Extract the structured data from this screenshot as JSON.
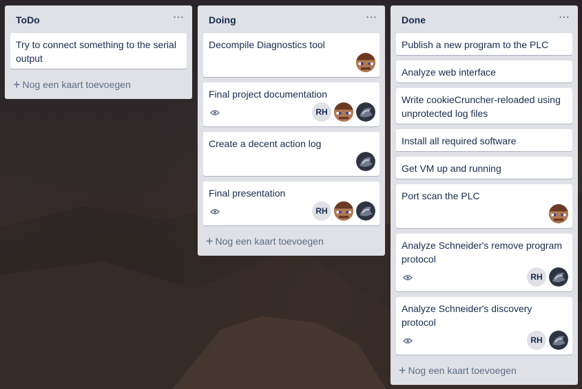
{
  "add_card_label": "Nog een kaart toevoegen",
  "lists": [
    {
      "title": "ToDo",
      "cards": [
        {
          "title": "Try to connect something to the serial output"
        }
      ]
    },
    {
      "title": "Doing",
      "cards": [
        {
          "title": "Decompile Diagnostics tool"
        },
        {
          "title": "Final project documentation",
          "initials": "RH"
        },
        {
          "title": "Create a decent action log"
        },
        {
          "title": "Final presentation",
          "initials": "RH"
        }
      ]
    },
    {
      "title": "Done",
      "cards": [
        {
          "title": "Publish a new program to the PLC"
        },
        {
          "title": "Analyze web interface"
        },
        {
          "title": "Write cookieCruncher-reloaded using unprotected log files"
        },
        {
          "title": "Install all required software"
        },
        {
          "title": "Get VM up and running"
        },
        {
          "title": "Port scan the PLC"
        },
        {
          "title": "Analyze Schneider's remove program protocol",
          "initials": "RH"
        },
        {
          "title": "Analyze Schneider's discovery protocol",
          "initials": "RH"
        }
      ]
    }
  ]
}
